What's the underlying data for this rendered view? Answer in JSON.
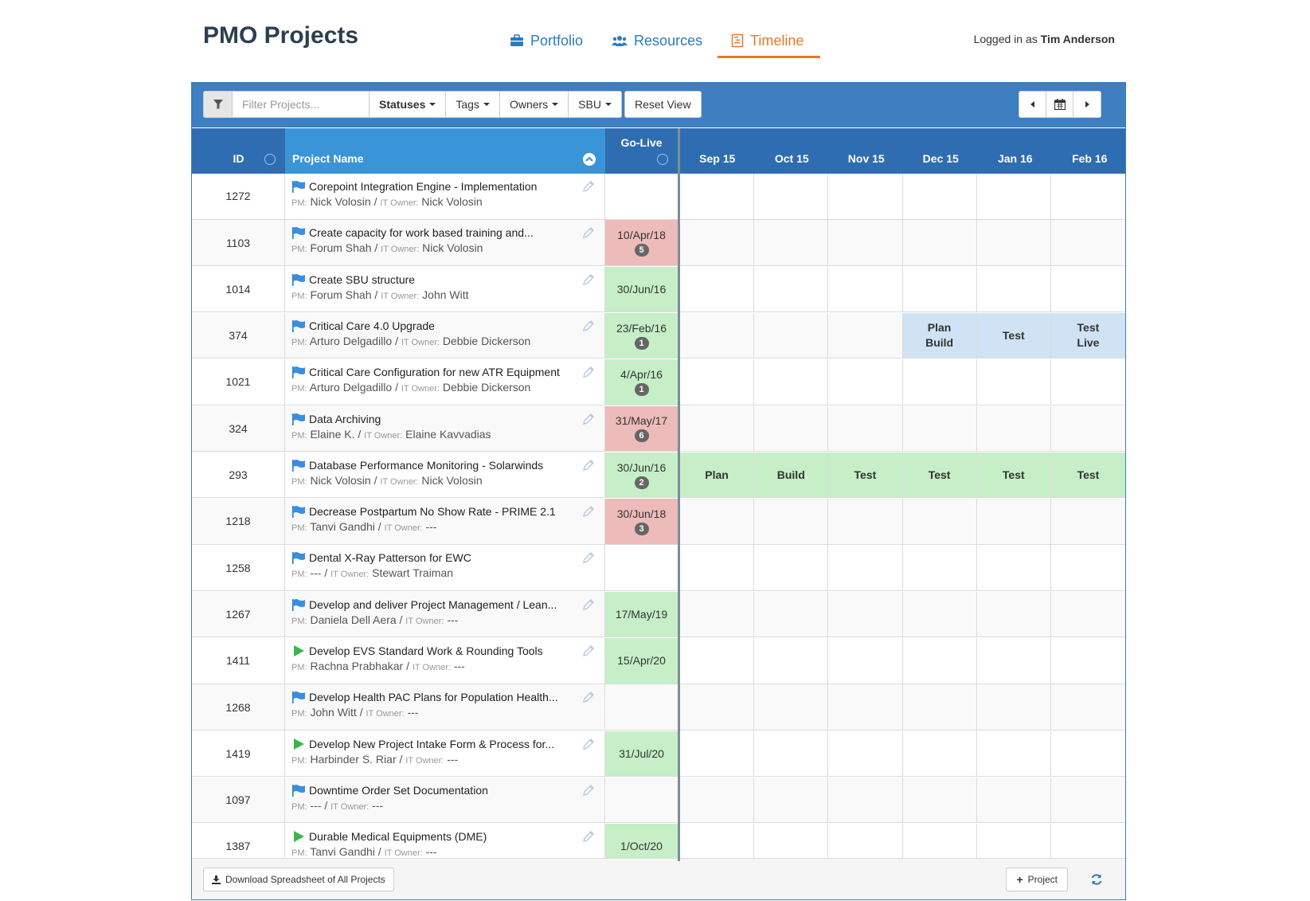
{
  "app": {
    "title": "PMO Projects",
    "login_prefix": "Logged in as",
    "user": "Tim Anderson"
  },
  "nav": [
    {
      "label": "Portfolio",
      "icon": "briefcase-icon",
      "active": false
    },
    {
      "label": "Resources",
      "icon": "users-icon",
      "active": false
    },
    {
      "label": "Timeline",
      "icon": "timeline-icon",
      "active": true
    }
  ],
  "toolbar": {
    "filter_placeholder": "Filter Projects...",
    "statuses": "Statuses",
    "tags": "Tags",
    "owners": "Owners",
    "sbu": "SBU",
    "reset": "Reset View"
  },
  "columns": {
    "id": "ID",
    "name": "Project Name",
    "golive": "Go-Live",
    "months": [
      "Sep 15",
      "Oct 15",
      "Nov 15",
      "Dec 15",
      "Jan 16",
      "Feb 16"
    ]
  },
  "labels": {
    "pm": "PM:",
    "it_owner": "IT Owner:"
  },
  "rows": [
    {
      "id": "1272",
      "name": "Corepoint Integration Engine - Implementation",
      "icon": "flag",
      "pm": "Nick Volosin",
      "owner": "Nick Volosin",
      "golive": "",
      "badge": "",
      "go_color": "",
      "timeline": [
        "",
        "",
        "",
        "",
        "",
        ""
      ],
      "tl_color": ""
    },
    {
      "id": "1103",
      "name": "Create capacity for work based training and...",
      "icon": "flag",
      "pm": "Forum Shah",
      "owner": "Nick Volosin",
      "golive": "10/Apr/18",
      "badge": "5",
      "go_color": "red",
      "timeline": [
        "",
        "",
        "",
        "",
        "",
        ""
      ],
      "tl_color": ""
    },
    {
      "id": "1014",
      "name": "Create SBU structure",
      "icon": "flag",
      "pm": "Forum Shah",
      "owner": "John Witt",
      "golive": "30/Jun/16",
      "badge": "",
      "go_color": "green",
      "timeline": [
        "",
        "",
        "",
        "",
        "",
        ""
      ],
      "tl_color": ""
    },
    {
      "id": "374",
      "name": "Critical Care 4.0 Upgrade",
      "icon": "flag",
      "pm": "Arturo Delgadillo",
      "owner": "Debbie Dickerson",
      "golive": "23/Feb/16",
      "badge": "1",
      "go_color": "green",
      "timeline": [
        "",
        "",
        "",
        "Plan\nBuild",
        "Test",
        "Test\nLive"
      ],
      "tl_color": "blue"
    },
    {
      "id": "1021",
      "name": "Critical Care Configuration for new ATR Equipment",
      "icon": "flag",
      "pm": "Arturo Delgadillo",
      "owner": "Debbie Dickerson",
      "golive": "4/Apr/16",
      "badge": "1",
      "go_color": "green",
      "timeline": [
        "",
        "",
        "",
        "",
        "",
        ""
      ],
      "tl_color": ""
    },
    {
      "id": "324",
      "name": "Data Archiving",
      "icon": "flag",
      "pm": "Elaine K.",
      "owner": "Elaine Kavvadias",
      "golive": "31/May/17",
      "badge": "6",
      "go_color": "red",
      "timeline": [
        "",
        "",
        "",
        "",
        "",
        ""
      ],
      "tl_color": ""
    },
    {
      "id": "293",
      "name": "Database Performance Monitoring - Solarwinds",
      "icon": "flag",
      "pm": "Nick Volosin",
      "owner": "Nick Volosin",
      "golive": "30/Jun/16",
      "badge": "2",
      "go_color": "green",
      "timeline": [
        "Plan",
        "Build",
        "Test",
        "Test",
        "Test",
        "Test"
      ],
      "tl_color": "green"
    },
    {
      "id": "1218",
      "name": "Decrease Postpartum No Show Rate - PRIME 2.1",
      "icon": "flag",
      "pm": "Tanvi Gandhi",
      "owner": "---",
      "golive": "30/Jun/18",
      "badge": "3",
      "go_color": "red",
      "timeline": [
        "",
        "",
        "",
        "",
        "",
        ""
      ],
      "tl_color": ""
    },
    {
      "id": "1258",
      "name": "Dental X-Ray Patterson for EWC",
      "icon": "flag",
      "pm": "---",
      "owner": "Stewart Traiman",
      "golive": "",
      "badge": "",
      "go_color": "",
      "timeline": [
        "",
        "",
        "",
        "",
        "",
        ""
      ],
      "tl_color": ""
    },
    {
      "id": "1267",
      "name": "Develop and deliver Project Management / Lean...",
      "icon": "flag",
      "pm": "Daniela Dell Aera",
      "owner": "---",
      "golive": "17/May/19",
      "badge": "",
      "go_color": "green",
      "timeline": [
        "",
        "",
        "",
        "",
        "",
        ""
      ],
      "tl_color": ""
    },
    {
      "id": "1411",
      "name": "Develop EVS Standard Work & Rounding Tools",
      "icon": "play",
      "pm": "Rachna Prabhakar",
      "owner": "---",
      "golive": "15/Apr/20",
      "badge": "",
      "go_color": "green",
      "timeline": [
        "",
        "",
        "",
        "",
        "",
        ""
      ],
      "tl_color": ""
    },
    {
      "id": "1268",
      "name": "Develop Health PAC Plans for Population Health...",
      "icon": "flag",
      "pm": "John Witt",
      "owner": "---",
      "golive": "",
      "badge": "",
      "go_color": "",
      "timeline": [
        "",
        "",
        "",
        "",
        "",
        ""
      ],
      "tl_color": ""
    },
    {
      "id": "1419",
      "name": "Develop New Project Intake Form & Process for...",
      "icon": "play",
      "pm": "Harbinder S. Riar",
      "owner": "---",
      "golive": "31/Jul/20",
      "badge": "",
      "go_color": "green",
      "timeline": [
        "",
        "",
        "",
        "",
        "",
        ""
      ],
      "tl_color": ""
    },
    {
      "id": "1097",
      "name": "Downtime Order Set Documentation",
      "icon": "flag",
      "pm": "---",
      "owner": "---",
      "golive": "",
      "badge": "",
      "go_color": "",
      "timeline": [
        "",
        "",
        "",
        "",
        "",
        ""
      ],
      "tl_color": ""
    },
    {
      "id": "1387",
      "name": "Durable Medical Equipments (DME)",
      "icon": "play",
      "pm": "Tanvi Gandhi",
      "owner": "---",
      "golive": "1/Oct/20",
      "badge": "",
      "go_color": "green",
      "timeline": [
        "",
        "",
        "",
        "",
        "",
        ""
      ],
      "tl_color": ""
    }
  ],
  "footer": {
    "download": "Download Spreadsheet of All Projects",
    "add_project": "Project"
  },
  "colors": {
    "nav_active": "#e8782a",
    "nav": "#2a7bc0",
    "header_bg": "#2f6db2",
    "golive_green": "#c6efc7",
    "golive_red": "#eebbbb",
    "timeline_blue": "#cfe3f5"
  }
}
